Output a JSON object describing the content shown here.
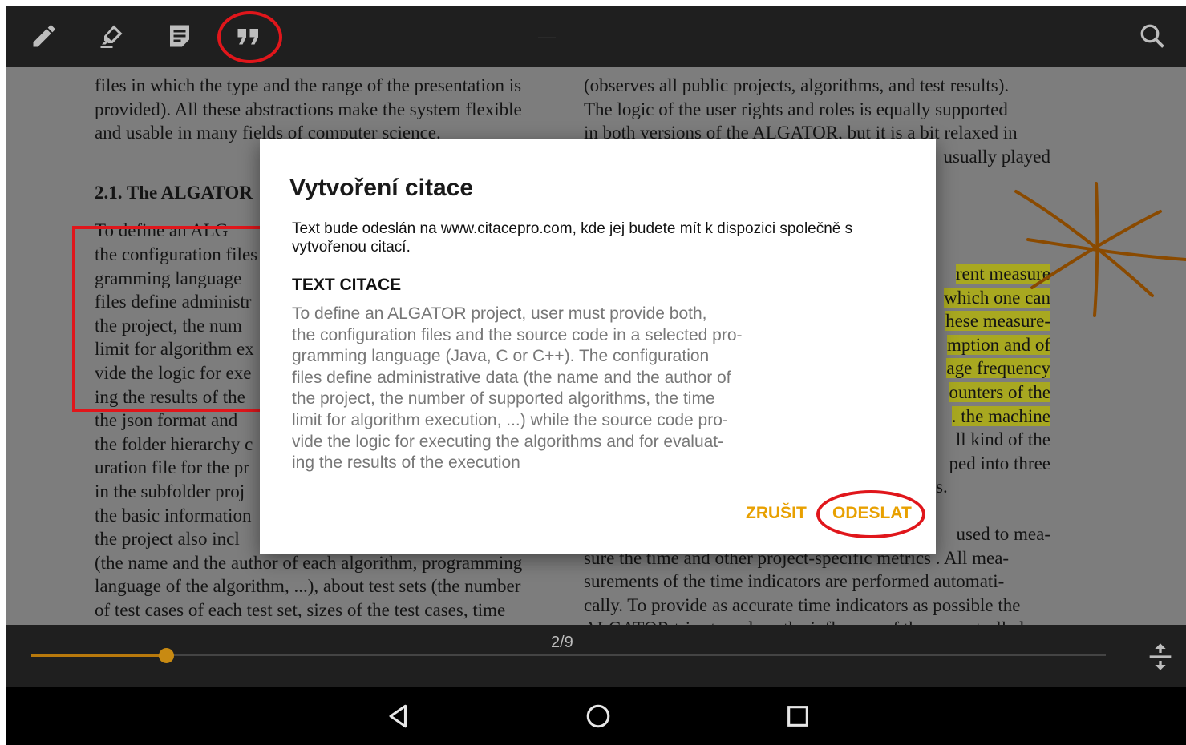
{
  "toolbar": {
    "icons": [
      "pencil-icon",
      "highlighter-icon",
      "note-icon",
      "quote-icon",
      "search-icon"
    ],
    "title_dash": "—"
  },
  "document": {
    "left": {
      "lines": [
        "files in which the type and the range of the presentation is",
        "provided). All these abstractions make the system flexible",
        "and usable in many fields of computer science."
      ],
      "heading": "2.1.  The ALGATOR",
      "lines2": [
        "   To define an ALG",
        "the configuration files",
        "gramming language",
        "files define administr",
        "the project, the num",
        "limit for algorithm ex",
        "vide the logic for exe",
        "ing the results of the",
        "the json format and",
        "the folder hierarchy c",
        "uration file for the pr",
        "in the subfolder proj",
        "the basic information",
        "the project also incl",
        "(the name and the author of each algorithm, programming",
        "language of the algorithm, ...), about test sets (the number",
        "of test cases of each test set, sizes of the test cases, time"
      ]
    },
    "right": {
      "lines": [
        "(observes all public projects, algorithms, and test results).",
        "The logic of the user rights and roles is equally supported",
        "in both versions of the ALGATOR, but it is a bit relaxed in",
        "usually played"
      ],
      "highlighted": [
        "rent measure",
        "which one can",
        "hese measure-",
        "mption and of",
        "age frequency",
        "ounters of the",
        ". the machine"
      ],
      "plain": [
        "ll kind of the",
        "ped into three",
        "s."
      ],
      "tail": [
        "used to mea-",
        "sure the time and other project-specific metrics . All mea-",
        "surements of the time indicators are performed automati-",
        "cally. To provide as accurate time indicators as possible the",
        "ALGATOR tries to reduce the influence of the uncontrolled"
      ]
    }
  },
  "dialog": {
    "title": "Vytvoření citace",
    "message": "Text bude odeslán na www.citacepro.com, kde jej budete mít k dispozici společně s vytvořenou citací.",
    "subtitle": "TEXT CITACE",
    "quote": "To define an ALGATOR project, user must provide both,\nthe configuration files and the source code in a selected pro-\ngramming language (Java, C or C++). The configuration\nfiles define administrative data (the name and the author of\nthe project, the number of supported algorithms, the time\nlimit for algorithm execution, ...) while the source code pro-\nvide the logic for executing the algorithms and for evaluat-\ning the results of the execution",
    "cancel_label": "ZRUŠIT",
    "send_label": "ODESLAT",
    "accent_color": "#e8a000"
  },
  "bottom": {
    "page_indicator": "2/9",
    "progress_fraction": 0.125
  },
  "nav": {
    "icons": [
      "back-icon",
      "home-icon",
      "recents-icon"
    ]
  }
}
